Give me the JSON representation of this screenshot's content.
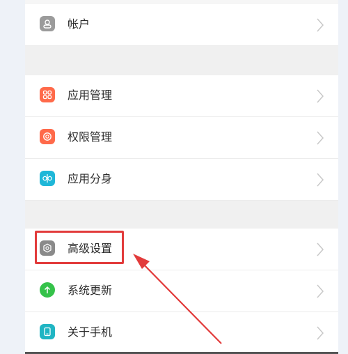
{
  "settings": {
    "items": [
      {
        "label": "帐户",
        "icon": "account-icon",
        "color": "#9b9b9b"
      },
      {
        "label": "应用管理",
        "icon": "apps-grid-icon",
        "color": "#ff6a4a"
      },
      {
        "label": "权限管理",
        "icon": "permission-icon",
        "color": "#ff6a4a"
      },
      {
        "label": "应用分身",
        "icon": "app-clone-icon",
        "color": "#1fb7d8"
      },
      {
        "label": "高级设置",
        "icon": "advanced-settings-icon",
        "color": "#8a8a8a"
      },
      {
        "label": "系统更新",
        "icon": "system-update-icon",
        "color": "#35c24a"
      },
      {
        "label": "关于手机",
        "icon": "about-phone-icon",
        "color": "#20b5c3"
      }
    ]
  },
  "annotation": {
    "highlight_color": "#e23b3b"
  }
}
